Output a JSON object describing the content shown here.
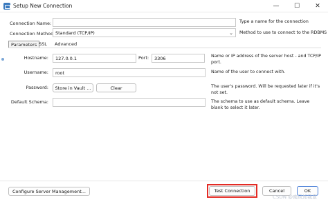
{
  "window": {
    "title": "Setup New Connection",
    "minimize_glyph": "—",
    "maximize_glyph": "☐",
    "close_glyph": "✕"
  },
  "form": {
    "connection_name": {
      "label": "Connection Name:",
      "value": "",
      "help": "Type a name for the connection"
    },
    "connection_method": {
      "label": "Connection Method:",
      "value": "Standard (TCP/IP)",
      "help": "Method to use to connect to the RDBMS"
    }
  },
  "tabs": [
    {
      "label": "Parameters",
      "active": true
    },
    {
      "label": "SSL",
      "active": false
    },
    {
      "label": "Advanced",
      "active": false
    }
  ],
  "parameters": {
    "hostname": {
      "label": "Hostname:",
      "value": "127.0.0.1"
    },
    "port": {
      "label": "Port:",
      "value": "3306"
    },
    "host_help": "Name or IP address of the server host - and TCP/IP port.",
    "username": {
      "label": "Username:",
      "value": "root",
      "help": "Name of the user to connect with."
    },
    "password": {
      "label": "Password:",
      "store_button": "Store in Vault ...",
      "clear_button": "Clear",
      "help": "The user's password. Will be requested later if it's not set."
    },
    "default_schema": {
      "label": "Default Schema:",
      "value": "",
      "help": "The schema to use as default schema. Leave blank to select it later."
    }
  },
  "footer": {
    "configure_button": "Configure Server Management...",
    "test_button": "Test Connection",
    "cancel_button": "Cancel",
    "ok_button": "OK"
  },
  "watermark": "CSDN @南风知我意",
  "colors": {
    "highlight": "#e32b24",
    "accent": "#4a7fd8",
    "icon": "#3b7bbf"
  }
}
